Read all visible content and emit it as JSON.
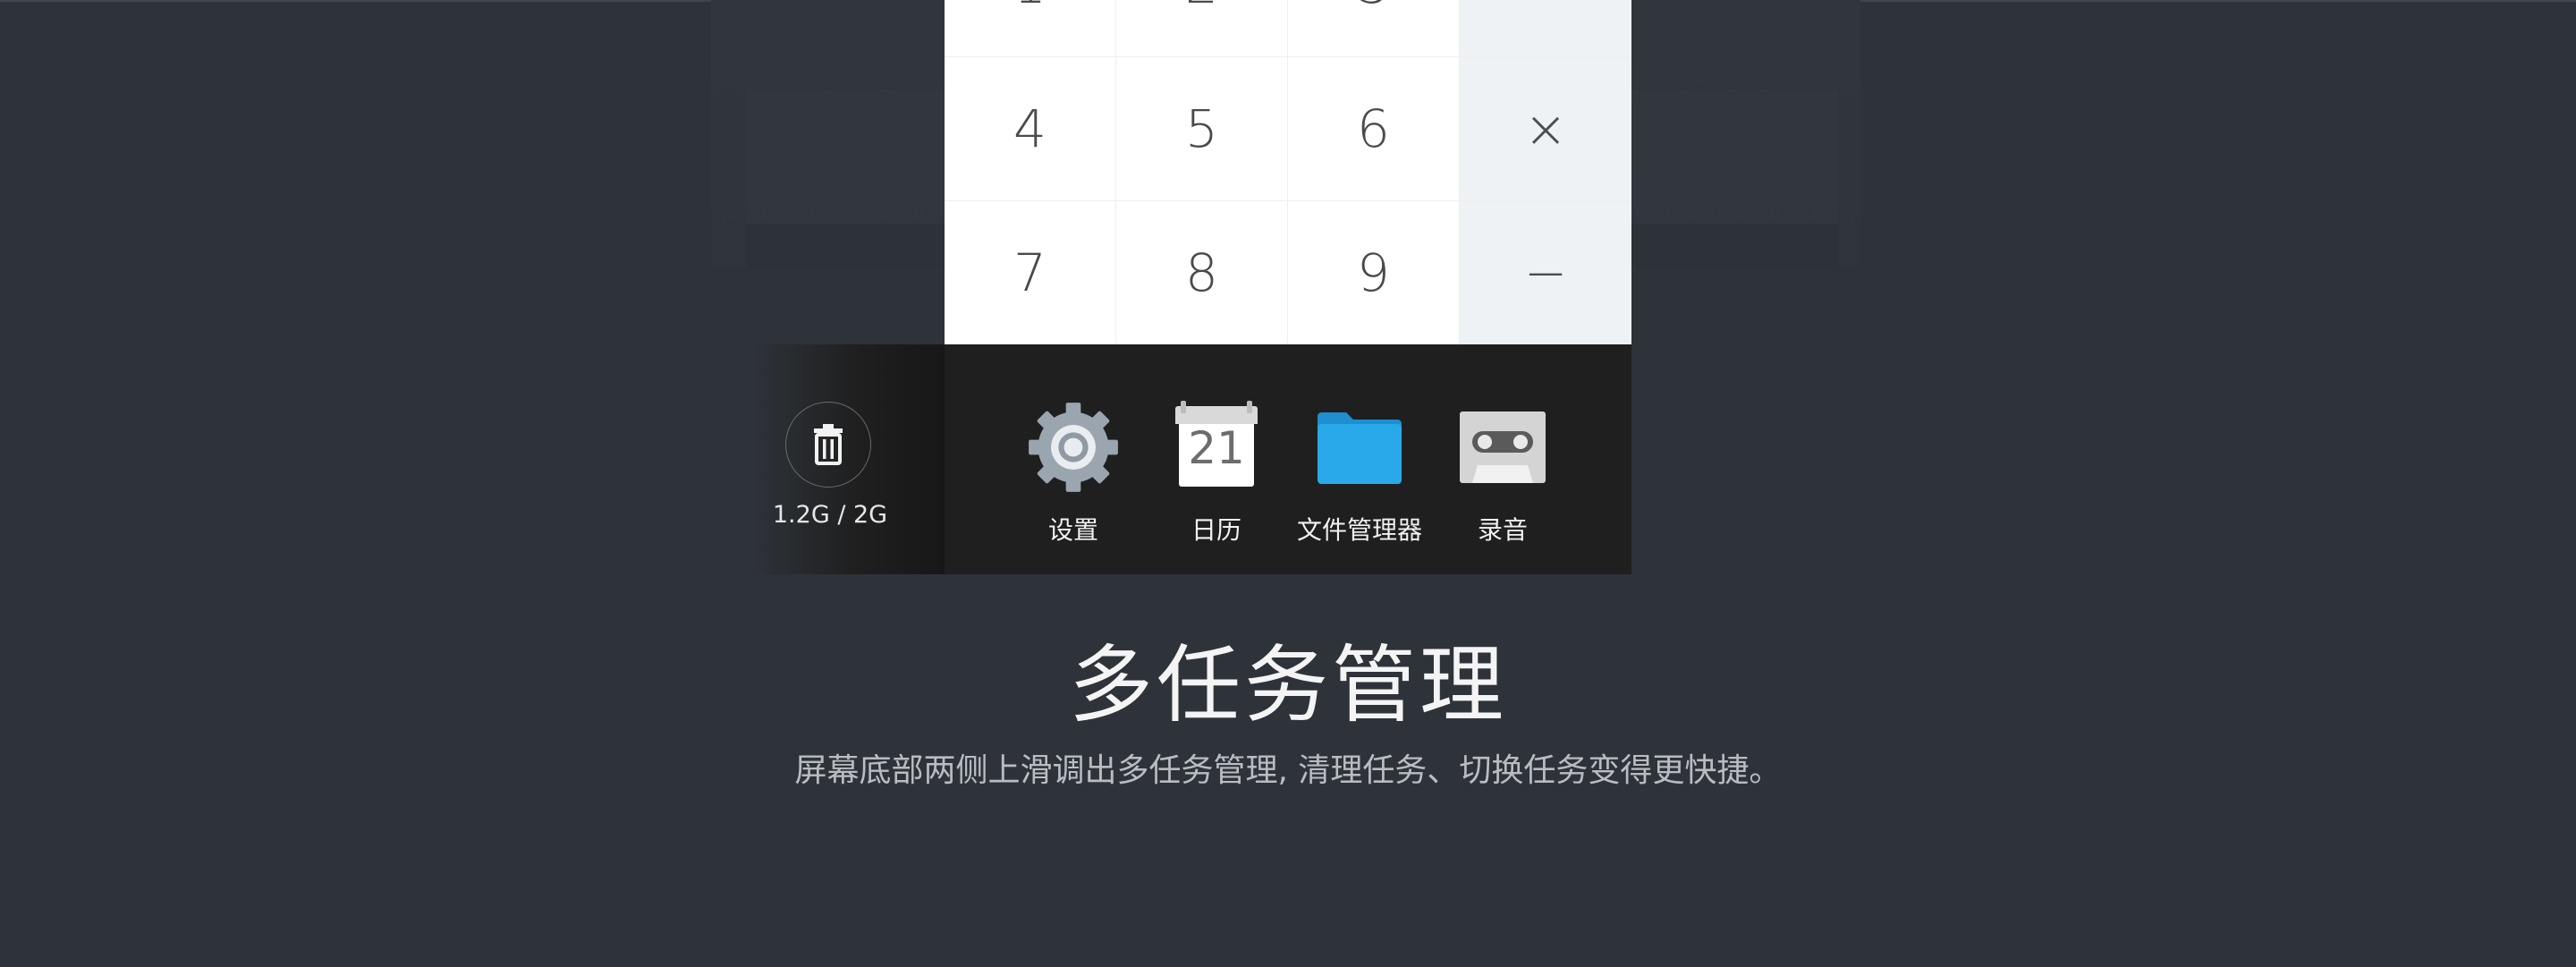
{
  "calculator": {
    "top_row": [
      "1",
      "2",
      "3",
      "÷"
    ],
    "keys": [
      [
        "4",
        "5",
        "6",
        "×"
      ],
      [
        "7",
        "8",
        "9",
        "−"
      ]
    ]
  },
  "memory": {
    "label": "1.2G / 2G",
    "icon": "trash-icon"
  },
  "apps": [
    {
      "label": "设置",
      "icon": "gear-icon"
    },
    {
      "label": "日历",
      "icon": "calendar-icon",
      "day": "21"
    },
    {
      "label": "文件管理器",
      "icon": "folder-icon"
    },
    {
      "label": "录音",
      "icon": "cassette-icon"
    }
  ],
  "feature": {
    "title": "多任务管理",
    "description": "屏幕底部两侧上滑调出多任务管理, 清理任务、切换任务变得更快捷。"
  },
  "colors": {
    "background": "#2e333a",
    "taskbar": "#1f1f1f",
    "operator_key_bg": "#eff2f5",
    "folder_blue": "#29a9ea",
    "gear_grey": "#9aa5b0"
  }
}
